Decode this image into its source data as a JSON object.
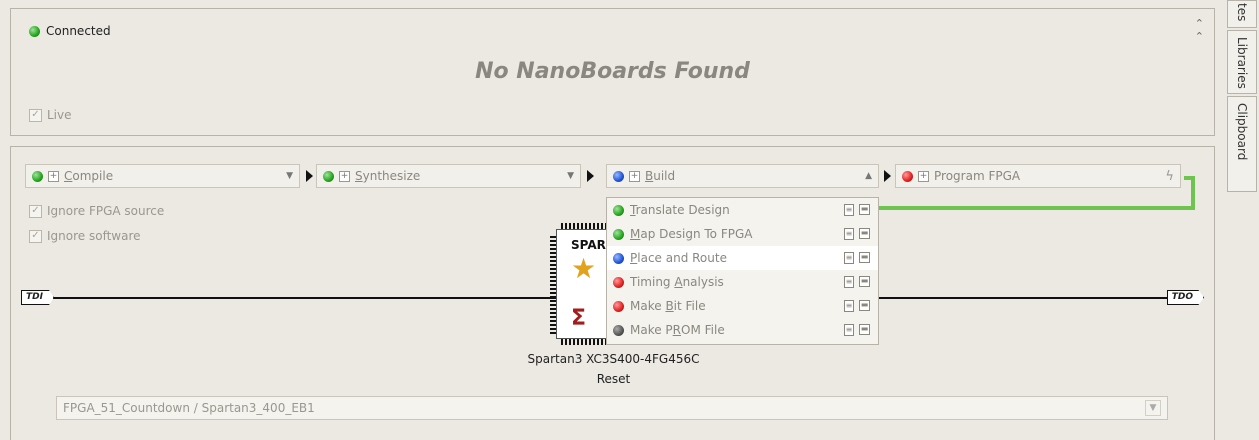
{
  "connection": {
    "status": "Connected",
    "collapse_glyph": "≈"
  },
  "nanoboards": {
    "message": "No NanoBoards Found",
    "live_label": "Live"
  },
  "flow": {
    "stages": [
      {
        "label_pre": "",
        "label_u": "C",
        "label_post": "ompile",
        "status": "green"
      },
      {
        "label_pre": "",
        "label_u": "S",
        "label_post": "ynthesize",
        "status": "green"
      },
      {
        "label_pre": "",
        "label_u": "B",
        "label_post": "uild",
        "status": "blue"
      },
      {
        "label_pre": "",
        "label_u": "P",
        "label_post": "rogram FPGA",
        "label_u2": "F",
        "status": "red"
      }
    ],
    "program_fpga_label": "Program FPGA",
    "ignore_fpga_source": "Ignore FPGA source",
    "ignore_software": "Ignore software"
  },
  "build_menu": {
    "items": [
      {
        "label_u": "T",
        "label_rest": "ranslate Design",
        "status": "green"
      },
      {
        "label_u": "M",
        "label_rest": "ap Design To FPGA",
        "status": "green"
      },
      {
        "label_u": "P",
        "label_rest": "lace and Route",
        "status": "blue"
      },
      {
        "label_pre": "Timing ",
        "label_u": "A",
        "label_rest": "nalysis",
        "status": "red"
      },
      {
        "label_pre": "Make ",
        "label_u": "B",
        "label_rest": "it File",
        "status": "red"
      },
      {
        "label_pre": "Make P",
        "label_u": "R",
        "label_rest": "OM File",
        "status": "gray"
      }
    ]
  },
  "jtag": {
    "tdi": "TDI",
    "tdo": "TDO"
  },
  "device": {
    "brand": "SPAR",
    "name": "Spartan3 XC3S400-4FG456C",
    "reset_label": "Reset"
  },
  "project": {
    "value": "FPGA_51_Countdown / Spartan3_400_EB1"
  },
  "side_tabs": [
    "tes",
    "Libraries",
    "Clipboard"
  ],
  "colors": {
    "green": "#23a31c",
    "blue": "#1f53d6",
    "red": "#e01f1f",
    "gray": "#555555",
    "wire": "#6dc550"
  }
}
